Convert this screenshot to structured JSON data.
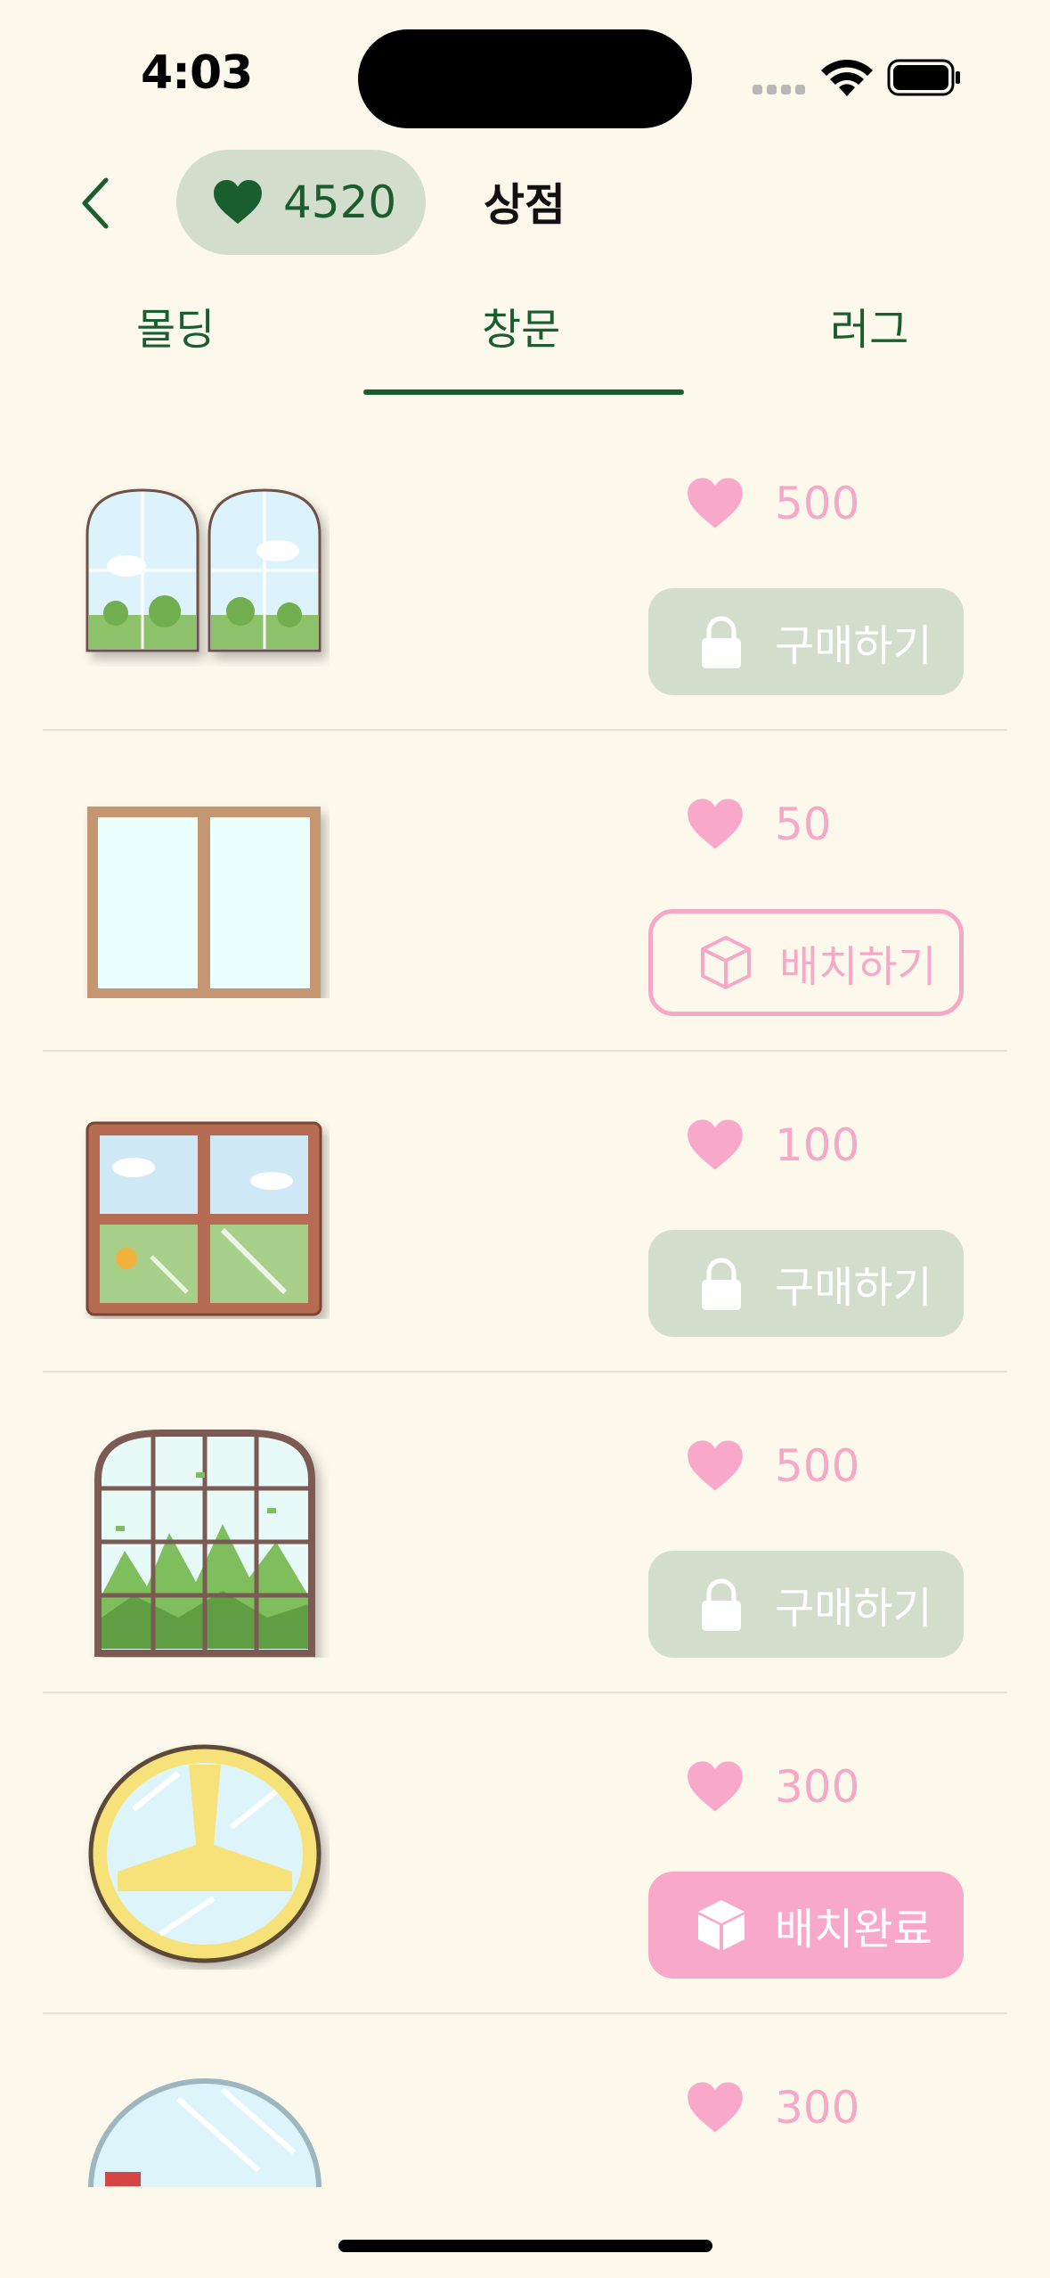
{
  "status_bar": {
    "time": "4:03"
  },
  "header": {
    "heart_count": "4520",
    "title": "상점"
  },
  "tabs": [
    {
      "label": "몰딩",
      "selected": false
    },
    {
      "label": "창문",
      "selected": true
    },
    {
      "label": "러그",
      "selected": false
    }
  ],
  "items": [
    {
      "price": "500",
      "action_label": "구매하기",
      "action_state": "locked",
      "thumbnail": "double-arch-window"
    },
    {
      "price": "50",
      "action_label": "배치하기",
      "action_state": "place",
      "thumbnail": "plain-wooden-window"
    },
    {
      "price": "100",
      "action_label": "구매하기",
      "action_state": "locked",
      "thumbnail": "four-pane-window"
    },
    {
      "price": "500",
      "action_label": "구매하기",
      "action_state": "locked",
      "thumbnail": "arched-grid-forest-window"
    },
    {
      "price": "300",
      "action_label": "배치완료",
      "action_state": "placed",
      "thumbnail": "round-yellow-window"
    },
    {
      "price": "300",
      "thumbnail": "round-blue-window"
    }
  ],
  "colors": {
    "background": "#FCF8EC",
    "accent_green": "#1A5E30",
    "pill_green": "#D2DDCB",
    "pink": "#F6A9C7",
    "pink_filled": "#F8A9C9"
  },
  "icons": {
    "back": "chevron-left-icon",
    "heart": "heart-icon",
    "lock": "lock-icon",
    "box": "cube-icon"
  }
}
